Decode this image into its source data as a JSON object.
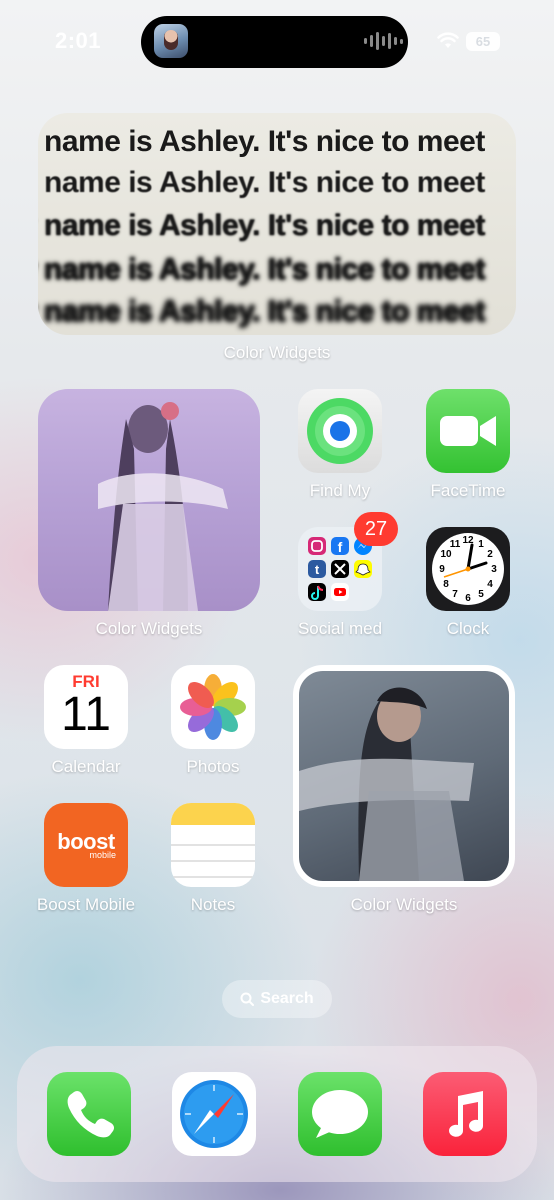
{
  "status_bar": {
    "time": "2:01",
    "battery": "65"
  },
  "widgets": {
    "text_widget": {
      "line": "y name is Ashley. It's nice to meet",
      "label": "Color Widgets"
    },
    "photo_widget_1": {
      "label": "Color Widgets"
    },
    "photo_widget_2": {
      "label": "Color Widgets"
    }
  },
  "apps": {
    "find_my": "Find My",
    "facetime": "FaceTime",
    "social": "Social med",
    "social_badge": "27",
    "clock": "Clock",
    "calendar": "Calendar",
    "calendar_day": "FRI",
    "calendar_date": "11",
    "photos": "Photos",
    "boost": "Boost Mobile",
    "boost_logo": "boost",
    "boost_sub": "mobile",
    "notes": "Notes"
  },
  "search": {
    "label": "Search"
  },
  "dock": [
    "phone-icon",
    "safari-icon",
    "messages-icon",
    "music-icon"
  ],
  "colors": {
    "facetime": "#34c232",
    "badge": "#ff3b30",
    "boost": "#f26522",
    "music": "#fa233b"
  }
}
